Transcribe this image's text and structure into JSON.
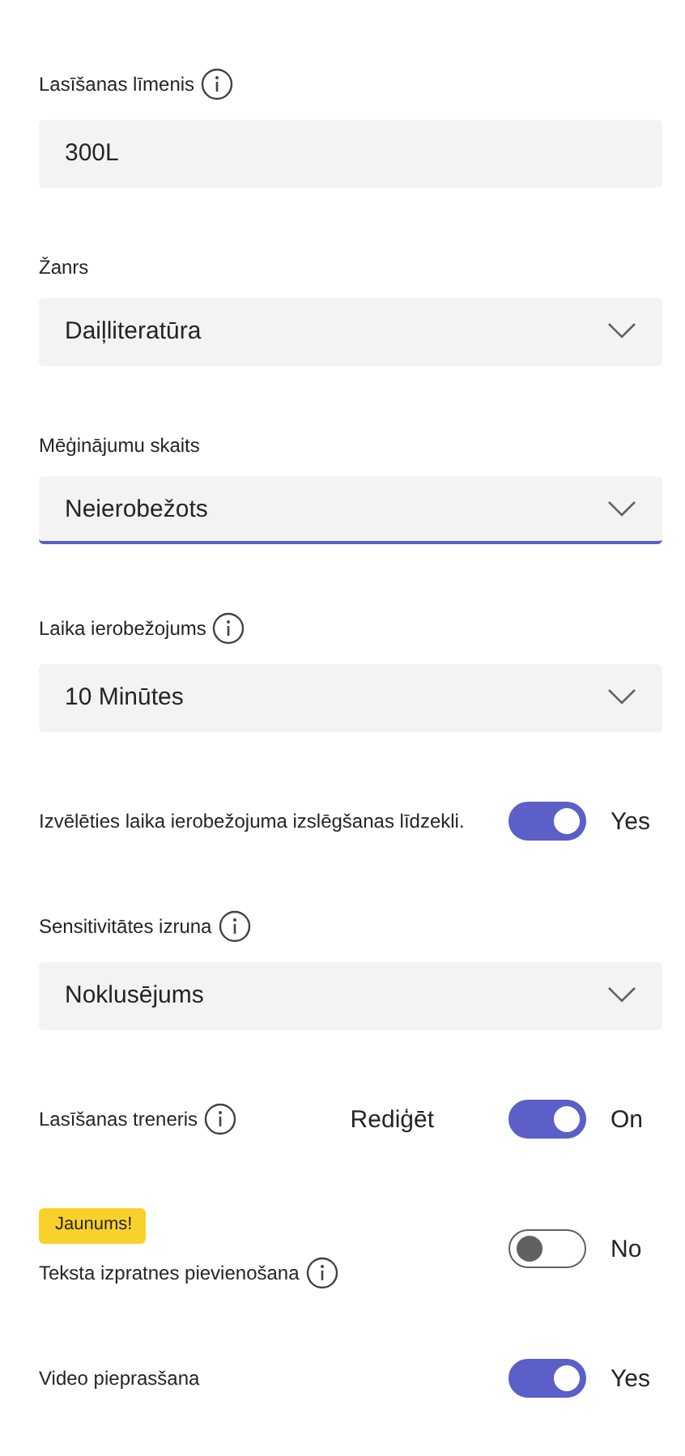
{
  "settings": [
    {
      "kind": "text-field",
      "label": "Lasīšanas līmenis",
      "info": true,
      "value": "300L"
    },
    {
      "kind": "dropdown",
      "label": "Žanrs",
      "info": false,
      "value": "Daiļliteratūra",
      "focused": false
    },
    {
      "kind": "dropdown",
      "label": "Mēģinājumu skaits",
      "info": false,
      "value": "Neierobežots",
      "focused": true
    },
    {
      "kind": "dropdown",
      "label": "Laika ierobežojums",
      "info": true,
      "value": "10 Minūtes",
      "focused": false
    },
    {
      "kind": "toggle",
      "label": "Izvēlēties laika ierobežojuma izslēgšanas līdzekli.",
      "info": false,
      "on": true,
      "state_text": "Yes"
    },
    {
      "kind": "dropdown",
      "label": "Sensitivitātes izruna",
      "info": true,
      "value": "Noklusējums",
      "focused": false
    },
    {
      "kind": "toggle",
      "label": "Lasīšanas treneris",
      "info": true,
      "link": "Rediģēt",
      "on": true,
      "state_text": "On"
    },
    {
      "kind": "toggle",
      "label": "Teksta izpratnes pievienošana",
      "info": true,
      "badge": "Jaunums!",
      "on": false,
      "state_text": "No"
    },
    {
      "kind": "toggle",
      "label": "Video pieprasšana",
      "info": false,
      "on": true,
      "state_text": "Yes"
    }
  ]
}
